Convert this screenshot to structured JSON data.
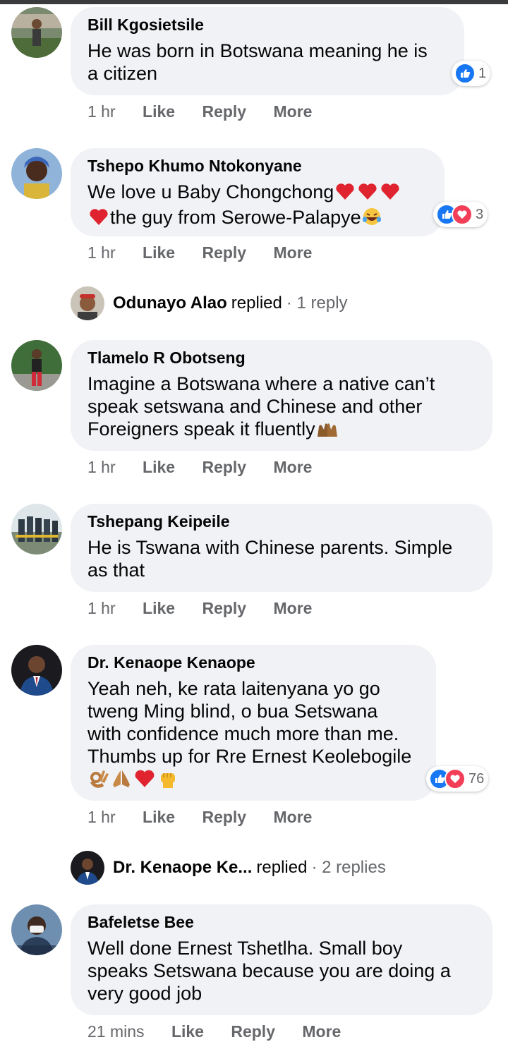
{
  "comments": [
    {
      "name": "Bill Kgosietsile",
      "text": "He was born in Botswana meaning he is\na citizen",
      "time": "1 hr",
      "reactions": "1"
    },
    {
      "name": "Tshepo Khumo Ntokonyane",
      "text_line1": "We love u Baby Chongchong",
      "text_line2": "the guy from Serowe-Palapye",
      "time": "1 hr",
      "reactions": "3"
    },
    {
      "name": "Tlamelo R Obotseng",
      "text": "Imagine a Botswana where a native can’t\nspeak setswana and Chinese and other\nForeigners speak it fluently",
      "time": "1 hr"
    },
    {
      "name": "Tshepang Keipeile",
      "text": "He is Tswana with Chinese parents. Simple\nas that",
      "time": "1 hr"
    },
    {
      "name": "Dr. Kenaope Kenaope",
      "text": "Yeah neh, ke rata laitenyana yo go\ntweng Ming blind, o bua Setswana\nwith confidence much more than me.\nThumbs up for Rre Ernest Keolebogile",
      "time": "1 hr",
      "reactions": "76"
    },
    {
      "name": "Bafeletse Bee",
      "text": "Well done Ernest Tshetlha. Small boy\nspeaks Setswana because you are doing a\nvery good job",
      "time": "21 mins"
    }
  ],
  "replies": [
    {
      "name": "Odunayo Alao",
      "verb": "replied",
      "count": "· 1 reply"
    },
    {
      "name": "Dr. Kenaope Ke...",
      "verb": "replied",
      "count": "· 2 replies"
    }
  ],
  "actions": {
    "like": "Like",
    "reply": "Reply",
    "more": "More"
  },
  "colors": {
    "like_blue": "#1877f2",
    "love_red": "#f33e58",
    "bubble": "#f0f2f5",
    "meta_gray": "#65676b"
  }
}
